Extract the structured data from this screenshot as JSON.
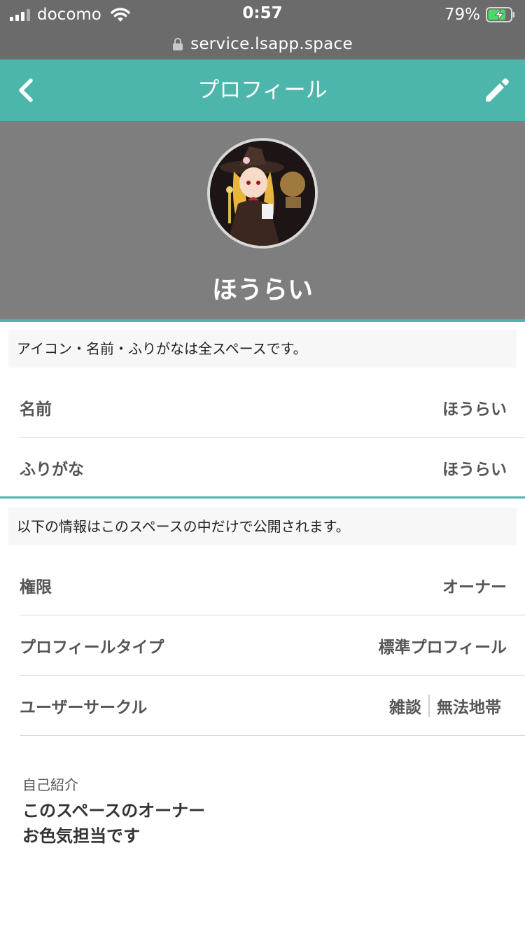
{
  "status_bar": {
    "carrier": "docomo",
    "time": "0:57",
    "battery_percent": "79%",
    "battery_level": 0.79
  },
  "browser": {
    "url": "service.lsapp.space"
  },
  "header": {
    "title": "プロフィール",
    "back_icon": "chevron-left-icon",
    "edit_icon": "pencil-icon",
    "color": "#4db6ac"
  },
  "profile": {
    "name": "ほうらい"
  },
  "public_section": {
    "notice": "アイコン・名前・ふりがなは全スペースです。",
    "rows": [
      {
        "label": "名前",
        "value": "ほうらい"
      },
      {
        "label": "ふりがな",
        "value": "ほうらい"
      }
    ]
  },
  "space_section": {
    "notice": "以下の情報はこのスペースの中だけで公開されます。",
    "rows": [
      {
        "label": "権限",
        "value": "オーナー"
      },
      {
        "label": "プロフィールタイプ",
        "value": "標準プロフィール"
      }
    ],
    "circles": {
      "label": "ユーザーサークル",
      "items": [
        "雑談",
        "無法地帯"
      ]
    }
  },
  "bio": {
    "title": "自己紹介",
    "line1": "このスペースのオーナー",
    "line2": "お色気担当です"
  }
}
